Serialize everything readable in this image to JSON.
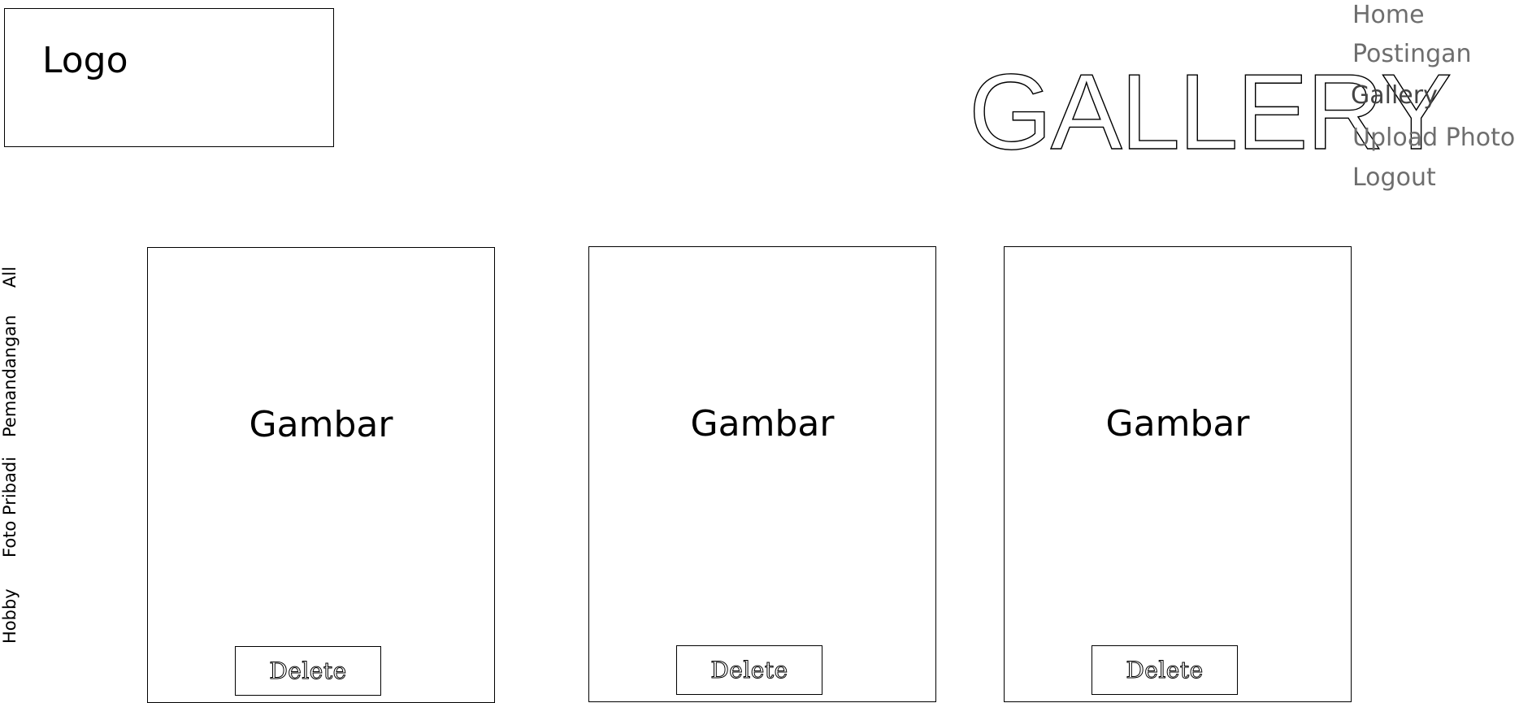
{
  "header": {
    "logo_text": "Logo",
    "page_title": "GALLERY"
  },
  "nav": {
    "items": [
      {
        "label": "Home"
      },
      {
        "label": "Postingan"
      },
      {
        "label": "Gallery",
        "active": true
      },
      {
        "label": "Upload Photo"
      },
      {
        "label": "Logout"
      }
    ]
  },
  "categories": [
    {
      "label": "All"
    },
    {
      "label": "Pemandangan"
    },
    {
      "label": "Foto Pribadi"
    },
    {
      "label": "Hobby"
    }
  ],
  "cards": [
    {
      "label": "Gambar",
      "action": "Delete"
    },
    {
      "label": "Gambar",
      "action": "Delete"
    },
    {
      "label": "Gambar",
      "action": "Delete"
    }
  ]
}
